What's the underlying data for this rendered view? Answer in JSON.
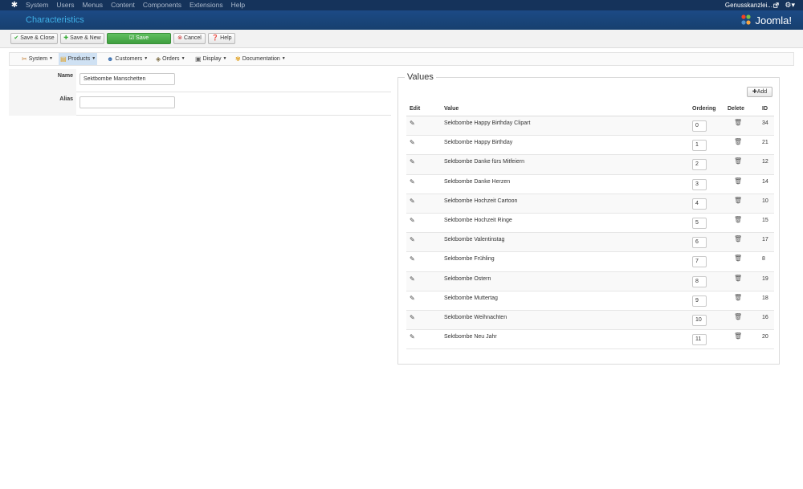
{
  "topbar": {
    "menu": [
      "System",
      "Users",
      "Menus",
      "Content",
      "Components",
      "Extensions",
      "Help"
    ],
    "site": "Genusskanzlei..."
  },
  "header": {
    "title": "Characteristics",
    "brand": "Joomla!"
  },
  "toolbar": {
    "save_close": "Save & Close",
    "save_new": "Save & New",
    "save": "Save",
    "cancel": "Cancel",
    "help": "Help"
  },
  "subnav": [
    {
      "label": "System",
      "icon": "wrench-icon"
    },
    {
      "label": "Products",
      "icon": "products-icon",
      "active": true
    },
    {
      "label": "Customers",
      "icon": "customers-icon"
    },
    {
      "label": "Orders",
      "icon": "orders-icon"
    },
    {
      "label": "Display",
      "icon": "display-icon"
    },
    {
      "label": "Documentation",
      "icon": "documentation-icon"
    }
  ],
  "form": {
    "name_label": "Name",
    "name_value": "Sektbombe Manschetten",
    "alias_label": "Alias",
    "alias_value": ""
  },
  "values": {
    "legend": "Values",
    "add_label": "Add",
    "columns": {
      "edit": "Edit",
      "value": "Value",
      "ordering": "Ordering",
      "delete": "Delete",
      "id": "ID"
    },
    "rows": [
      {
        "value": "Sektbombe Happy Birthday Clipart",
        "ordering": "0",
        "id": "34"
      },
      {
        "value": "Sektbombe Happy Birthday",
        "ordering": "1",
        "id": "21"
      },
      {
        "value": "Sektbombe Danke fürs Mitfeiern",
        "ordering": "2",
        "id": "12"
      },
      {
        "value": "Sektbombe Danke Herzen",
        "ordering": "3",
        "id": "14"
      },
      {
        "value": "Sektbombe Hochzeit Cartoon",
        "ordering": "4",
        "id": "10"
      },
      {
        "value": "Sektbombe Hochzeit Ringe",
        "ordering": "5",
        "id": "15"
      },
      {
        "value": "Sektbombe Valentinstag",
        "ordering": "6",
        "id": "17"
      },
      {
        "value": "Sektbombe Frühling",
        "ordering": "7",
        "id": "8"
      },
      {
        "value": "Sektbombe Ostern",
        "ordering": "8",
        "id": "19"
      },
      {
        "value": "Sektbombe Muttertag",
        "ordering": "9",
        "id": "18"
      },
      {
        "value": "Sektbombe Weihnachten",
        "ordering": "10",
        "id": "16"
      },
      {
        "value": "Sektbombe Neu Jahr",
        "ordering": "11",
        "id": "20"
      }
    ]
  },
  "colors": {
    "topbar": "#15335b",
    "header": "#1c4a85",
    "title": "#3fb0e6",
    "save": "#4cae4c",
    "active_tab": "#cfe1f3"
  }
}
